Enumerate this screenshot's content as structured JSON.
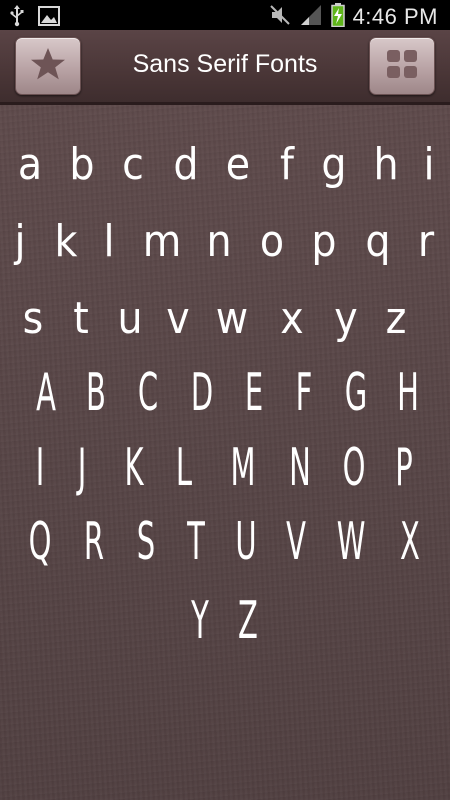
{
  "status_bar": {
    "time": "4:46 PM",
    "left_icons": [
      "usb-icon",
      "image-icon"
    ],
    "right_icons": [
      "mute-icon",
      "signal-icon",
      "battery-charging-icon"
    ]
  },
  "action_bar": {
    "title": "Sans Serif Fonts",
    "left_button_icon": "star-icon",
    "right_button_icon": "grid-icon"
  },
  "alphabet": {
    "rows": [
      [
        "a",
        "b",
        "c",
        "d",
        "e",
        "f",
        "g",
        "h",
        "i"
      ],
      [
        "j",
        "k",
        "l",
        "m",
        "n",
        "o",
        "p",
        "q",
        "r"
      ],
      [
        "s",
        "t",
        "u",
        "v",
        "w",
        "x",
        "y",
        "z"
      ],
      [
        "A",
        "B",
        "C",
        "D",
        "E",
        "F",
        "G",
        "H"
      ],
      [
        "I",
        "J",
        "K",
        "L",
        "M",
        "N",
        "O",
        "P"
      ],
      [
        "Q",
        "R",
        "S",
        "T",
        "U",
        "V",
        "W",
        "X"
      ],
      [
        "Y",
        "Z"
      ]
    ]
  },
  "colors": {
    "background": "#564445",
    "glyph": "#ffffff",
    "button": "#bba6a8"
  }
}
